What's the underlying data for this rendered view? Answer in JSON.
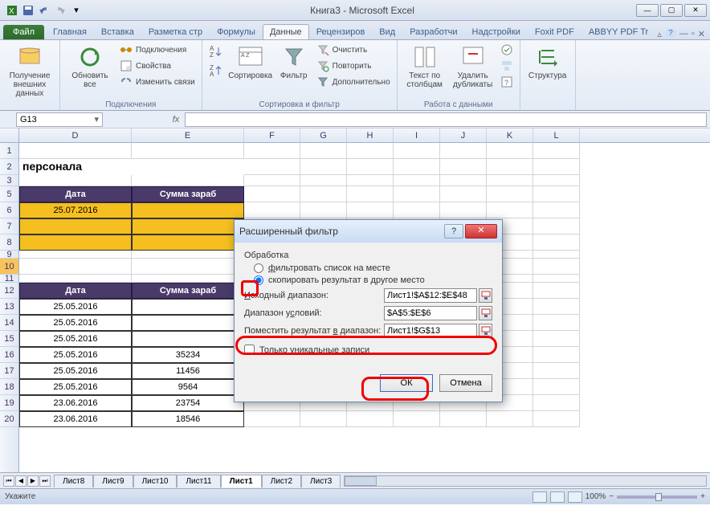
{
  "app_title": "Книга3  -  Microsoft Excel",
  "tabs": {
    "file": "Файл",
    "home": "Главная",
    "insert": "Вставка",
    "layout": "Разметка стр",
    "formulas": "Формулы",
    "data": "Данные",
    "review": "Рецензиров",
    "view": "Вид",
    "developer": "Разработчи",
    "addins": "Надстройки",
    "foxit": "Foxit PDF",
    "abbyy": "ABBYY PDF Tr"
  },
  "ribbon": {
    "get_external": "Получение внешних данных",
    "refresh_all": "Обновить все",
    "connections": "Подключения",
    "properties": "Свойства",
    "edit_links": "Изменить связи",
    "group_connections": "Подключения",
    "sort": "Сортировка",
    "filter": "Фильтр",
    "clear": "Очистить",
    "reapply": "Повторить",
    "advanced": "Дополнительно",
    "group_sort": "Сортировка и фильтр",
    "text_to_cols": "Текст по столбцам",
    "remove_dup": "Удалить дубликаты",
    "group_tools": "Работа с данными",
    "structure": "Структура"
  },
  "namebox": "G13",
  "sheet": {
    "title_row": "персонала",
    "hdr_date": "Дата",
    "hdr_salary": "Сумма зараб",
    "crit_date": "25.07.2016",
    "data_hdr_date": "Дата",
    "data_hdr_salary": "Сумма зараб",
    "rows": [
      {
        "d": "25.05.2016",
        "e": ""
      },
      {
        "d": "25.05.2016",
        "e": ""
      },
      {
        "d": "25.05.2016",
        "e": ""
      },
      {
        "d": "25.05.2016",
        "e": "35234"
      },
      {
        "d": "25.05.2016",
        "e": "11456"
      },
      {
        "d": "25.05.2016",
        "e": "9564"
      },
      {
        "d": "23.06.2016",
        "e": "23754"
      },
      {
        "d": "23.06.2016",
        "e": "18546"
      }
    ]
  },
  "sheets": [
    "Лист8",
    "Лист9",
    "Лист10",
    "Лист11",
    "Лист1",
    "Лист2",
    "Лист3"
  ],
  "active_sheet": "Лист1",
  "status_left": "Укажите",
  "zoom": "100%",
  "dialog": {
    "title": "Расширенный фильтр",
    "processing": "Обработка",
    "opt_inplace": "фильтровать список на месте",
    "opt_copy": "скопировать результат в другое место",
    "src_label": "Исходный диапазон:",
    "src_val": "Лист1!$A$12:$E$48",
    "crit_label": "Диапазон условий:",
    "crit_val": "$A$5:$E$6",
    "copy_label": "Поместить результат в диапазон:",
    "copy_val": "Лист1!$G$13",
    "unique": "Только уникальные записи",
    "ok": "ОК",
    "cancel": "Отмена"
  },
  "cols": [
    "D",
    "E",
    "F",
    "G",
    "H",
    "I",
    "J",
    "K",
    "L"
  ]
}
